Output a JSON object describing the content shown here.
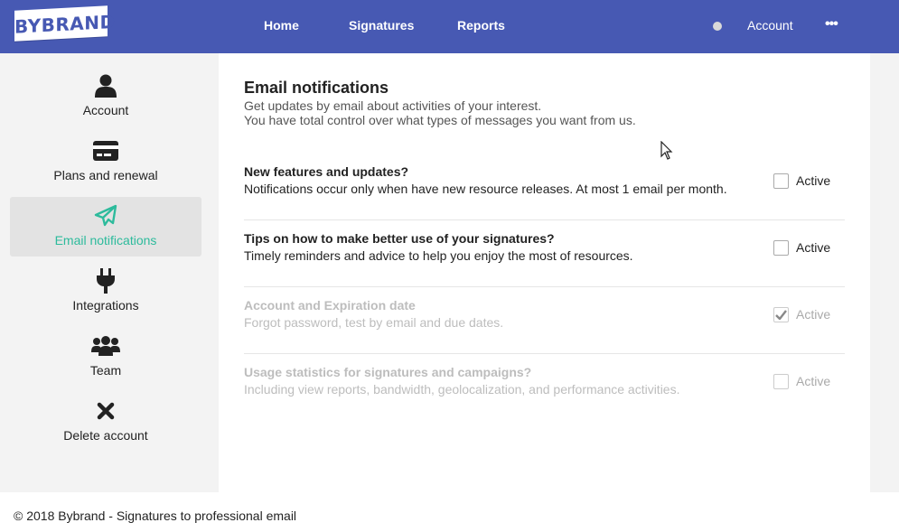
{
  "brand": {
    "logo_text": "BYBRAND",
    "nav_color": "#4759b3",
    "accent": "#2dbb9c"
  },
  "nav": {
    "home": "Home",
    "signatures": "Signatures",
    "reports": "Reports",
    "account": "Account",
    "more": "•••"
  },
  "sidebar": {
    "items": [
      {
        "label": "Account",
        "icon": "user-icon",
        "active": false
      },
      {
        "label": "Plans and renewal",
        "icon": "credit-card-icon",
        "active": false
      },
      {
        "label": "Email notifications",
        "icon": "paper-plane-icon",
        "active": true
      },
      {
        "label": "Integrations",
        "icon": "plug-icon",
        "active": false
      },
      {
        "label": "Team",
        "icon": "users-icon",
        "active": false
      },
      {
        "label": "Delete account",
        "icon": "close-icon",
        "active": false
      }
    ]
  },
  "main": {
    "title": "Email notifications",
    "subtitle_line1": "Get updates by email about activities of your interest.",
    "subtitle_line2": "You have total control over what types of messages you want from us.",
    "notifications": [
      {
        "title": "New features and updates?",
        "description": "Notifications occur only when have new resource releases. At most 1 email per month.",
        "checkbox_label": "Active",
        "checked": false,
        "disabled": false
      },
      {
        "title": "Tips on how to make better use of your signatures?",
        "description": "Timely reminders and advice to help you enjoy the most of resources.",
        "checkbox_label": "Active",
        "checked": false,
        "disabled": false
      },
      {
        "title": "Account and Expiration date",
        "description": "Forgot password, test by email and due dates.",
        "checkbox_label": "Active",
        "checked": true,
        "disabled": true
      },
      {
        "title": "Usage statistics for signatures and campaigns?",
        "description": "Including view reports, bandwidth, geolocalization, and performance activities.",
        "checkbox_label": "Active",
        "checked": false,
        "disabled": true
      }
    ]
  },
  "footer": {
    "text": "© 2018 Bybrand - Signatures to professional email"
  }
}
